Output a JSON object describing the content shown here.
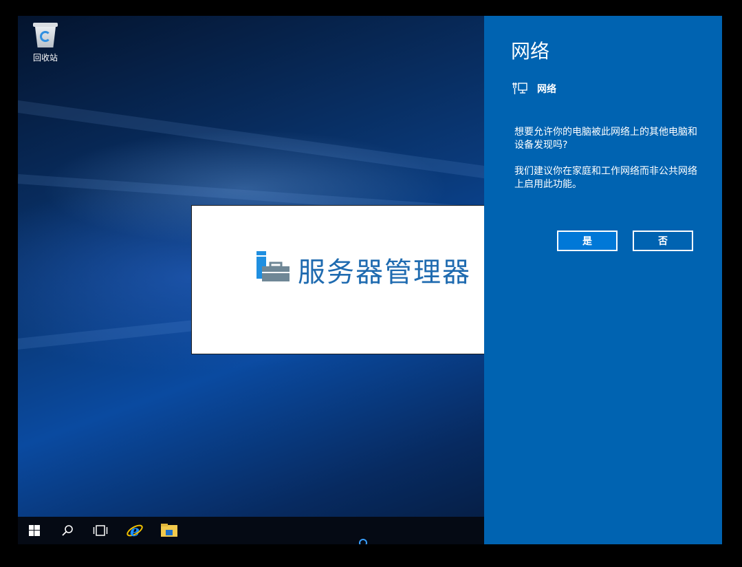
{
  "desktop": {
    "recycle_bin_label": "回收站"
  },
  "splash": {
    "title": "服务器管理器"
  },
  "flyout": {
    "title": "网络",
    "network_name": "网络",
    "question": "想要允许你的电脑被此网络上的其他电脑和设备发现吗?",
    "recommendation": "我们建议你在家庭和工作网络而非公共网络上启用此功能。",
    "yes_label": "是",
    "no_label": "否"
  },
  "taskbar": {
    "icons": [
      "windows-start-icon",
      "search-icon",
      "task-view-icon",
      "internet-explorer-icon",
      "file-explorer-icon"
    ]
  },
  "colors": {
    "flyout_bg": "#0063b1",
    "accent": "#0078d7",
    "splash_title": "#1f6bb0"
  }
}
